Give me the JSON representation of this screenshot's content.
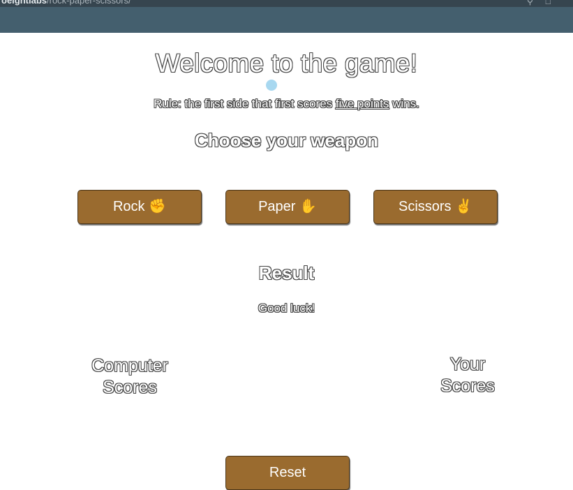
{
  "browser": {
    "url_bold": "oeightlabs",
    "url_rest": "/rock-paper-scissors/",
    "icons": [
      "search-icon",
      "share-icon"
    ]
  },
  "game": {
    "title": "Welcome to the game!",
    "rule_prefix": "Rule: the first side that first scores ",
    "rule_emphasis": "five points",
    "rule_suffix": " wins.",
    "choose_heading": "Choose your weapon",
    "buttons": {
      "rock": "Rock ✊",
      "paper": "Paper ✋",
      "scissors": "Scissors ✌️",
      "reset": "Reset"
    },
    "result_heading": "Result",
    "result_message": "Good luck!",
    "computer_scores_line1": "Computer",
    "computer_scores_line2": "Scores",
    "your_scores_line1": "Your",
    "your_scores_line2": "Scores"
  },
  "colors": {
    "header_bg": "#445f6e",
    "browser_bar_bg": "#36454f",
    "button_bg": "#9a6b2f",
    "cursor_dot": "#a8d8f0"
  }
}
